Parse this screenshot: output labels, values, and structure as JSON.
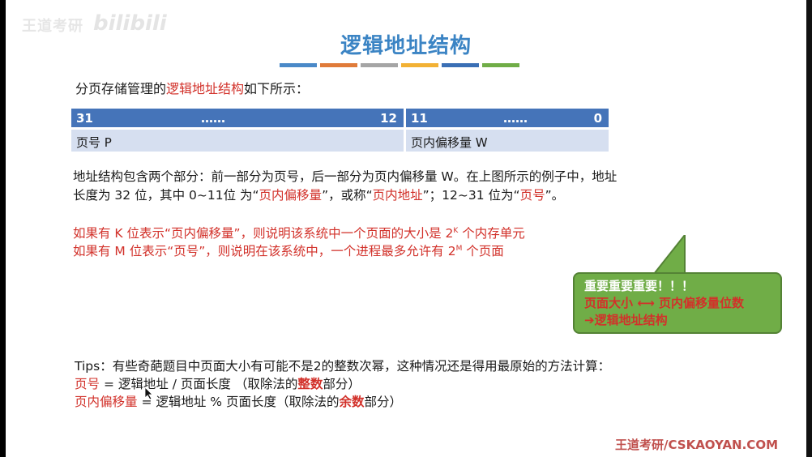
{
  "watermark": {
    "left": "王道考研",
    "logo": "bilibili"
  },
  "title": "逻辑地址结构",
  "colors": {
    "bars": [
      "#4a89c8",
      "#e07b39",
      "#a5a5a5",
      "#f2b134",
      "#3a6fb5",
      "#70ad47"
    ]
  },
  "intro": {
    "pre": "分页存储管理的",
    "highlight": "逻辑地址结构",
    "post": "如下所示："
  },
  "table": {
    "left_header": {
      "hi": "31",
      "mid": "……",
      "lo": "12"
    },
    "right_header": {
      "hi": "11",
      "mid": "……",
      "lo": "0"
    },
    "left_body": "页号 P",
    "right_body": "页内偏移量 W"
  },
  "para": {
    "line1": "地址结构包含两个部分：前一部分为页号，后一部分为页内偏移量 W。在上图所示的例子中，地址",
    "line2_a": "长度为 32 位，其中 0~11位 为“",
    "line2_b": "页内偏移量",
    "line2_c": "”，或称“",
    "line2_d": "页内地址",
    "line2_e": "”；12~31 位为“",
    "line2_f": "页号",
    "line2_g": "”。"
  },
  "red_lines": {
    "k_a": "如果有 K 位表示“页内偏移量”，则说明该系统中一个页面的大小是 2",
    "k_sup": "K",
    "k_b": " 个内存单元",
    "m_a": "如果有 M 位表示“页号”，则说明在该系统中，一个进程最多允许有 2",
    "m_sup": "M",
    "m_b": " 个页面"
  },
  "callout": {
    "line1": "重要重要重要！！！",
    "line2": "页面大小 ⟷ 页内偏移量位数",
    "line3": "➔逻辑地址结构"
  },
  "tips": {
    "line1": "Tips：有些奇葩题目中页面大小有可能不是2的整数次幂，这种情况还是得用最原始的方法计算：",
    "l2_red": "页号",
    "l2_a": " = 逻辑地址 / 页面长度 （取除法的",
    "l2_red2": "整数",
    "l2_b": "部分）",
    "l3_red": "页内偏移量",
    "l3_a": " = 逻辑地址 % 页面长度（取除法的",
    "l3_red2": "余数",
    "l3_b": "部分）"
  },
  "footer": "王道考研/CSKAOYAN.COM"
}
